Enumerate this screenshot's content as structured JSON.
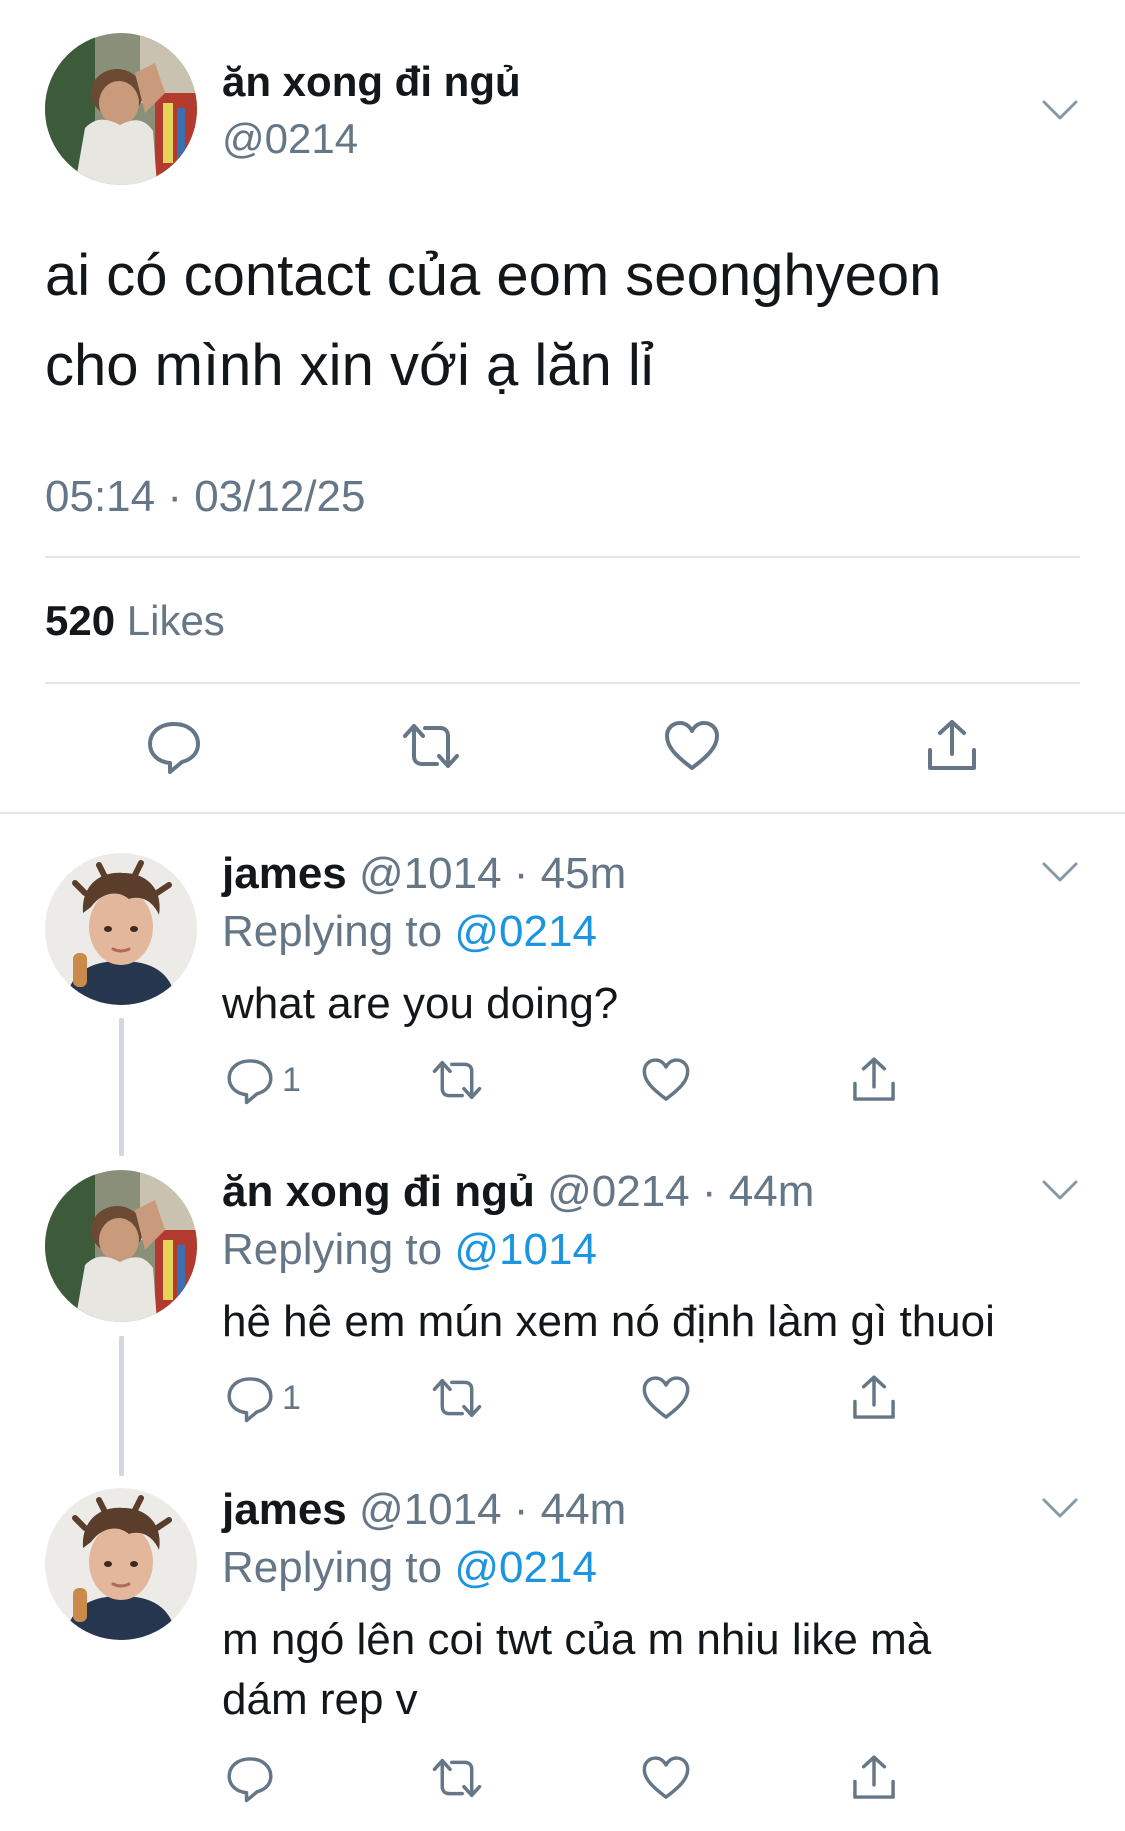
{
  "main_tweet": {
    "display_name": "ăn xong đi ngủ",
    "handle": "@0214",
    "text_line1": "ai có contact của eom seonghyeon",
    "text_line2": "cho mình xin với ạ lăn lỉ",
    "timestamp": "05:14 · 03/12/25",
    "likes_count": "520",
    "likes_label": "Likes"
  },
  "replies": [
    {
      "display_name": "james",
      "handle": "@1014",
      "time": "· 45m",
      "replying_label": "Replying to",
      "replying_to": "@0214",
      "text_line1": "what are you doing?",
      "text_line2": "",
      "reply_count": "1"
    },
    {
      "display_name": "ăn xong đi ngủ",
      "handle": "@0214",
      "time": "· 44m",
      "replying_label": "Replying to",
      "replying_to": "@1014",
      "text_line1": "hê hê em mún xem nó định làm gì thuoi",
      "text_line2": "",
      "reply_count": "1"
    },
    {
      "display_name": "james",
      "handle": "@1014",
      "time": "· 44m",
      "replying_label": "Replying to",
      "replying_to": "@0214",
      "text_line1": "m ngó lên coi twt của m nhiu like mà",
      "text_line2": "dám rep v",
      "reply_count": ""
    }
  ],
  "icons": {
    "reply": "reply-icon",
    "retweet": "retweet-icon",
    "like": "heart-icon",
    "share": "share-icon",
    "more": "chevron-down-icon"
  },
  "colors": {
    "text": "#14171a",
    "muted": "#657786",
    "link": "#1b95e0",
    "divider": "#e1e8ed"
  }
}
